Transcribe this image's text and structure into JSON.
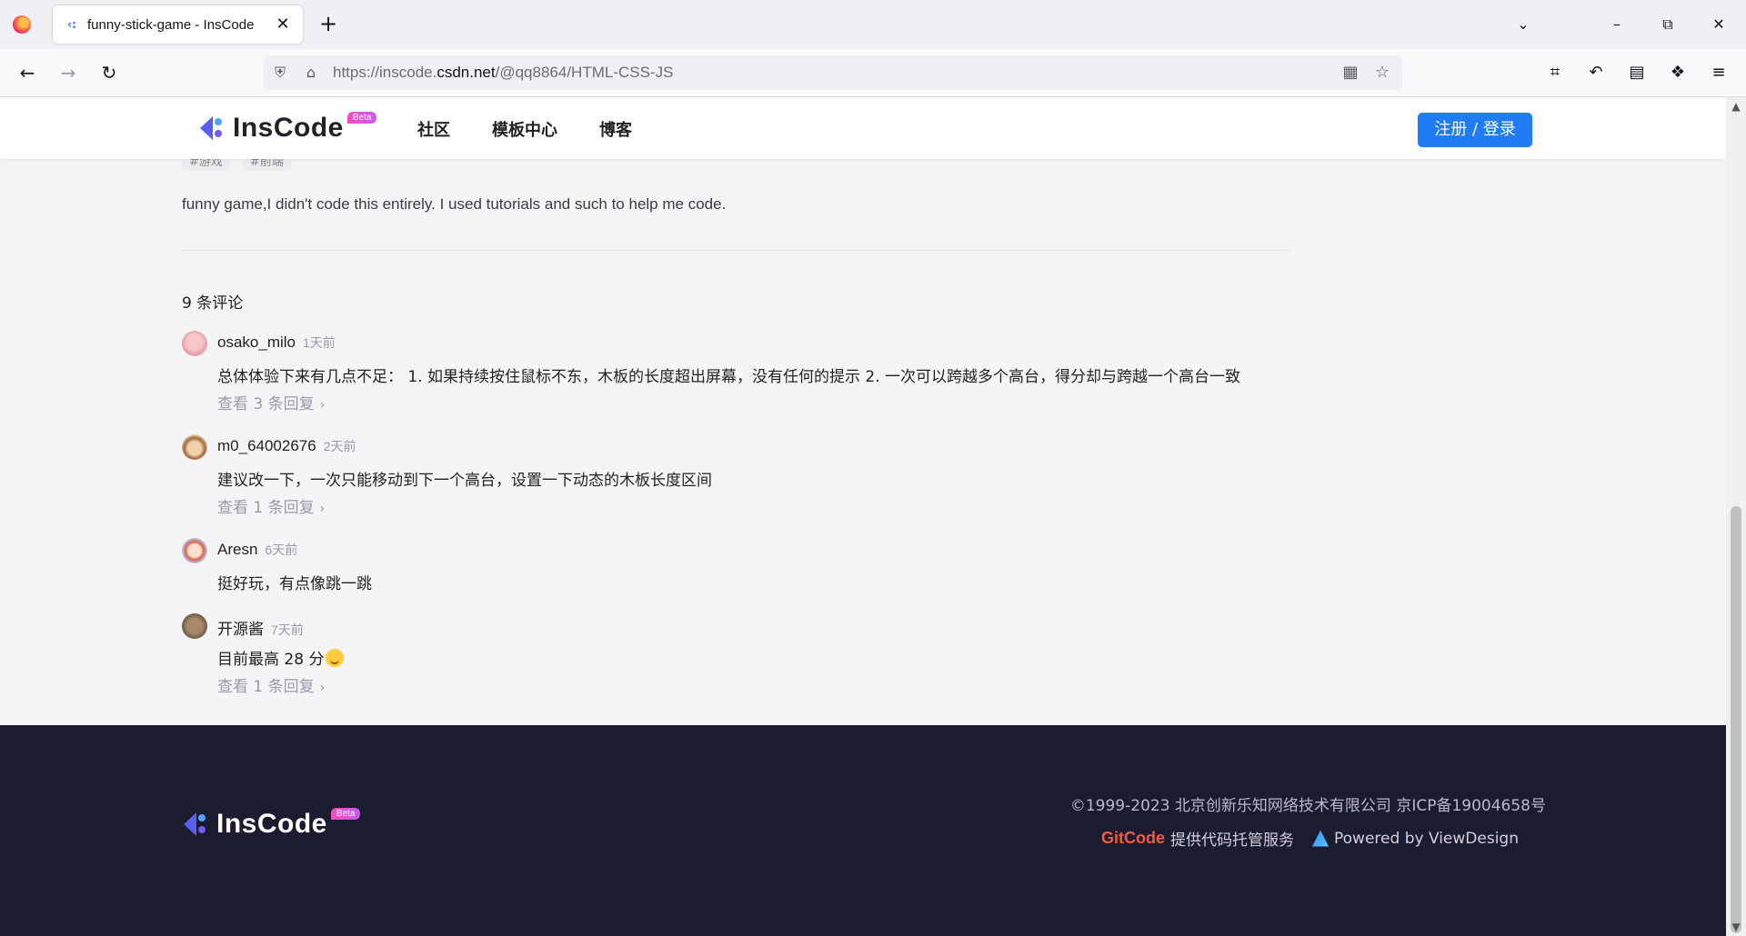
{
  "browser": {
    "tab_title": "funny-stick-game - InsCode",
    "tab_favicon": "‹:",
    "tab_close": "✕",
    "new_tab": "+",
    "tab_list": "⌄",
    "url_scheme": "https://inscode.",
    "url_host": "csdn.net",
    "url_path": "/@qq8864/HTML-CSS-JS",
    "icons": {
      "back": "←",
      "forward": "→",
      "reload": "↻",
      "minimize": "–",
      "restore": "⧉",
      "close": "✕",
      "shield": "⛨",
      "lock": "⌂",
      "qr": "▦",
      "star": "☆",
      "crop": "⌗",
      "undo": "↶",
      "reader": "▤",
      "extensions": "❖",
      "menu": "≡"
    }
  },
  "header": {
    "logo_text": "InsCode",
    "beta": "Beta",
    "nav": [
      "社区",
      "模板中心",
      "博客"
    ],
    "login": "注册 / 登录"
  },
  "project": {
    "tags": [
      "#游戏",
      "#前端"
    ],
    "description": "funny game,I didn't code this entirely. I used tutorials and such to help me code."
  },
  "comments": {
    "count_label": "9  条评论",
    "items": [
      {
        "user": "osako_milo",
        "time": "1天前",
        "body": "总体体验下来有几点不足： 1. 如果持续按住鼠标不东，木板的长度超出屏幕，没有任何的提示 2. 一次可以跨越多个高台，得分却与跨越一个高台一致",
        "replies": "查看 3 条回复"
      },
      {
        "user": "m0_64002676",
        "time": "2天前",
        "body": "建议改一下，一次只能移动到下一个高台，设置一下动态的木板长度区间",
        "replies": "查看 1 条回复"
      },
      {
        "user": "Aresn",
        "time": "6天前",
        "body": "挺好玩，有点像跳一跳",
        "replies": ""
      },
      {
        "user": "开源酱",
        "time": "7天前",
        "body": "目前最高 28 分",
        "replies": "查看 1 条回复"
      }
    ]
  },
  "footer": {
    "logo_text": "InsCode",
    "beta": "Beta",
    "copyright": "©1999-2023 北京创新乐知网络技术有限公司 京ICP备19004658号",
    "gitcode": "GitCode",
    "gitcode_text": "提供代码托管服务",
    "viewdesign": "Powered by ViewDesign"
  },
  "colors": {
    "accent": "#1f7cf5",
    "footer_bg": "#1c1c31",
    "muted": "#999aaa"
  }
}
